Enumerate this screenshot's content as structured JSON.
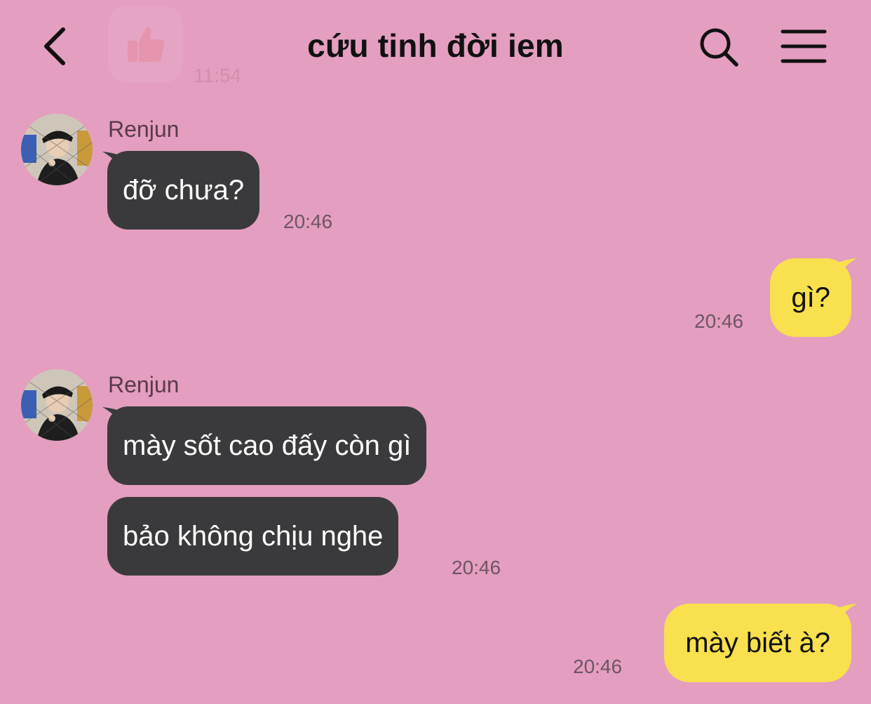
{
  "header": {
    "title": "cứu tinh đời iem",
    "ghost_time": "11:54"
  },
  "messages": [
    {
      "side": "in",
      "sender": "Renjun",
      "text": "đỡ chưa?",
      "time": "20:46"
    },
    {
      "side": "out",
      "text": "gì?",
      "time": "20:46"
    },
    {
      "side": "in",
      "sender": "Renjun",
      "text": "mày sốt cao đấy còn gì"
    },
    {
      "side": "in",
      "text": "bảo không chịu nghe",
      "time": "20:46"
    },
    {
      "side": "out",
      "text": "mày biết à?",
      "time": "20:46"
    }
  ],
  "colors": {
    "background": "#e49ebf",
    "incoming_bubble": "#3a3a3c",
    "outgoing_bubble": "#f8e04e"
  },
  "icons": {
    "back": "chevron-left-icon",
    "search": "search-icon",
    "menu": "hamburger-menu-icon",
    "sticker": "thumbs-up-icon"
  }
}
